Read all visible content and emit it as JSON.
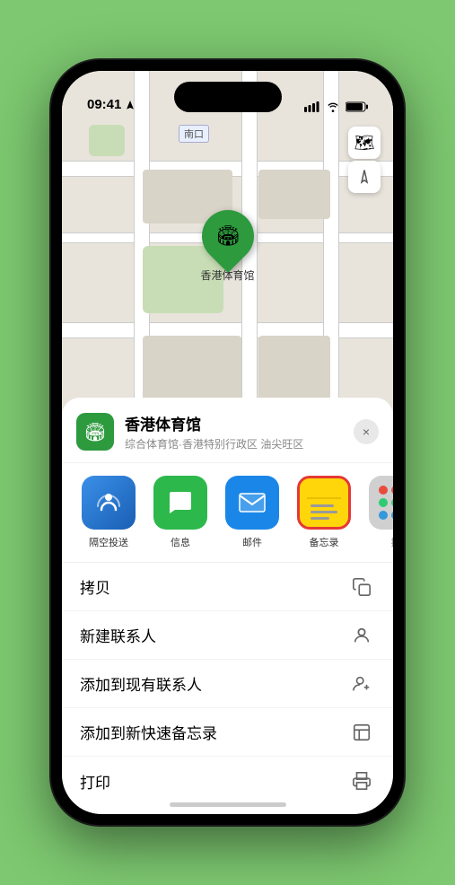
{
  "status_bar": {
    "time": "09:41",
    "location_arrow": true
  },
  "map": {
    "label_text": "南口",
    "pin_emoji": "🏟",
    "venue_name_on_map": "香港体育馆"
  },
  "map_controls": {
    "layers_icon": "🗺",
    "location_icon": "➤"
  },
  "bottom_sheet": {
    "venue_icon_emoji": "🏟",
    "venue_name": "香港体育馆",
    "venue_subtitle": "综合体育馆·香港特别行政区 油尖旺区",
    "close_label": "×"
  },
  "share_items": [
    {
      "id": "airdrop",
      "label": "隔空投送",
      "type": "airdrop"
    },
    {
      "id": "messages",
      "label": "信息",
      "type": "messages"
    },
    {
      "id": "mail",
      "label": "邮件",
      "type": "mail"
    },
    {
      "id": "notes",
      "label": "备忘录",
      "type": "notes"
    },
    {
      "id": "more",
      "label": "提",
      "type": "more"
    }
  ],
  "actions": [
    {
      "id": "copy",
      "label": "拷贝",
      "icon": "copy"
    },
    {
      "id": "new-contact",
      "label": "新建联系人",
      "icon": "person"
    },
    {
      "id": "add-contact",
      "label": "添加到现有联系人",
      "icon": "person-add"
    },
    {
      "id": "quick-note",
      "label": "添加到新快速备忘录",
      "icon": "note"
    },
    {
      "id": "print",
      "label": "打印",
      "icon": "print"
    }
  ],
  "colors": {
    "green_accent": "#2d9a3e",
    "map_bg": "#e8e4dc",
    "sheet_bg": "#ffffff",
    "notes_yellow": "#ffd60a",
    "notes_border_red": "#e53935"
  }
}
